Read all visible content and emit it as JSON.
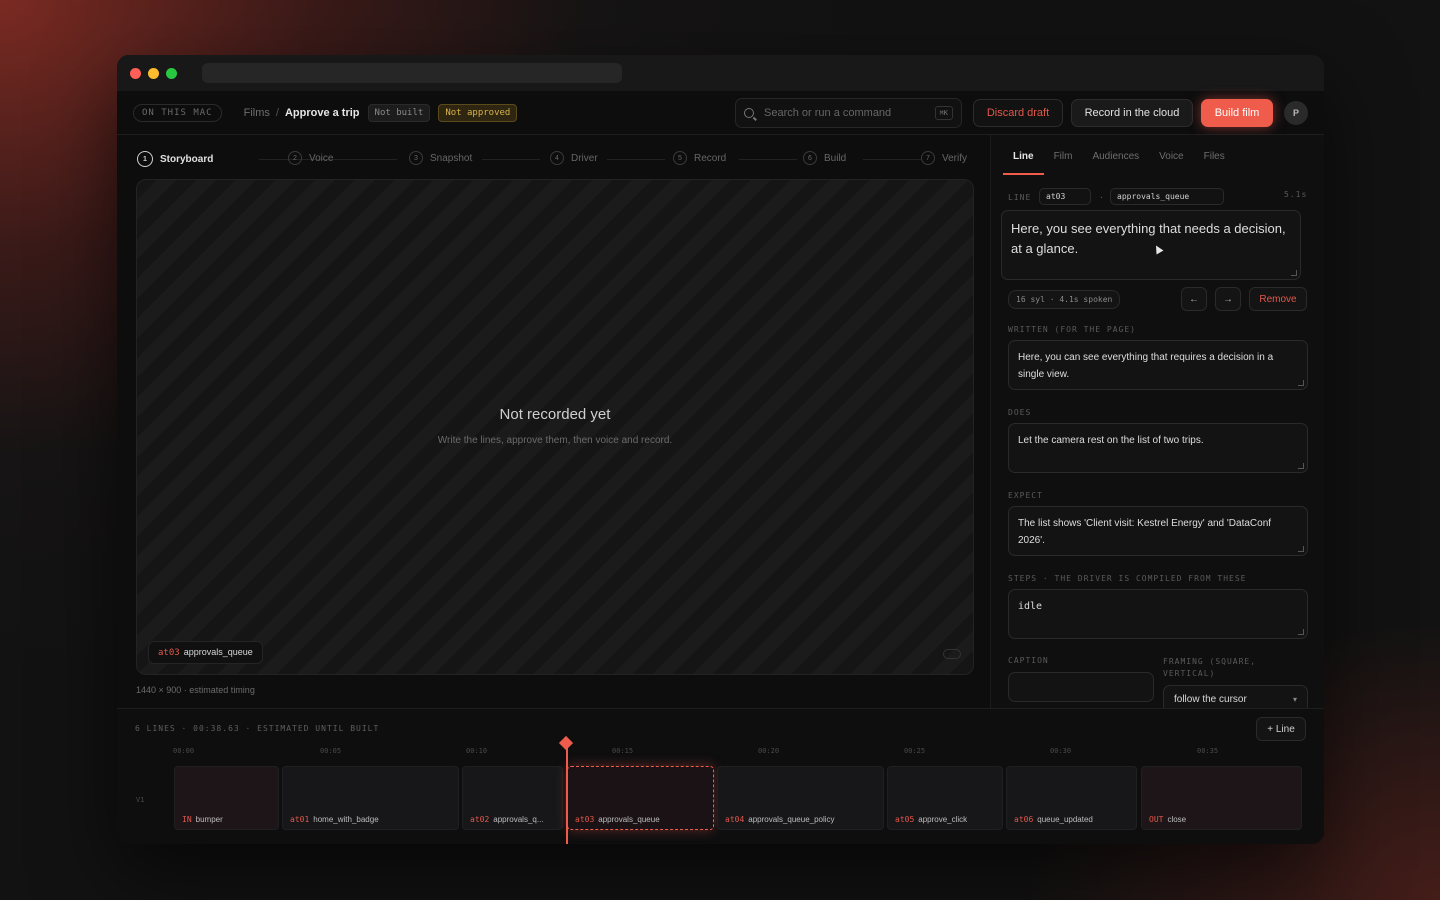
{
  "topbar": {
    "location": "ON THIS MAC",
    "breadcrumb_root": "Films",
    "breadcrumb_sep": "/",
    "breadcrumb_current": "Approve a trip",
    "badge_built": "Not built",
    "badge_approved": "Not approved",
    "search_placeholder": "Search or run a command",
    "search_shortcut": "⌘K",
    "discard_label": "Discard draft",
    "cloud_label": "Record in the cloud",
    "build_label": "Build film",
    "avatar_initial": "P"
  },
  "stepper": [
    {
      "num": "1",
      "label": "Storyboard"
    },
    {
      "num": "2",
      "label": "Voice"
    },
    {
      "num": "3",
      "label": "Snapshot"
    },
    {
      "num": "4",
      "label": "Driver"
    },
    {
      "num": "5",
      "label": "Record"
    },
    {
      "num": "6",
      "label": "Build"
    },
    {
      "num": "7",
      "label": "Verify"
    }
  ],
  "stage": {
    "title": "Not recorded yet",
    "subtitle": "Write the lines, approve them, then voice and record.",
    "chip_id": "at03",
    "chip_name": "approvals_queue",
    "dims": "1440 × 900 · estimated timing"
  },
  "panel": {
    "tabs": [
      "Line",
      "Film",
      "Audiences",
      "Voice",
      "Files"
    ],
    "line_label": "LINE",
    "line_id": "at03",
    "line_sep": "·",
    "line_name": "approvals_queue",
    "line_time": "5.1s",
    "spoken_text": "Here, you see everything that needs a decision, at a glance.",
    "stats": "16 syl · 4.1s spoken",
    "prev_label": "←",
    "next_label": "→",
    "remove_label": "Remove",
    "written_label": "WRITTEN (FOR THE PAGE)",
    "written_text": "Here, you can see everything that requires a decision in a single view.",
    "does_label": "DOES",
    "does_text": "Let the camera rest on the list of two trips.",
    "expect_label": "EXPECT",
    "expect_text": "The list shows 'Client visit: Kestrel Energy' and 'DataConf 2026'.",
    "steps_label": "STEPS · THE DRIVER IS COMPILED FROM THESE",
    "steps_text": "idle",
    "caption_label": "CAPTION",
    "caption_value": "",
    "framing_label": "FRAMING (SQUARE, VERTICAL)",
    "framing_value": "follow the cursor"
  },
  "timeline": {
    "header": "6 LINES · 00:38.63 · ESTIMATED UNTIL BUILT",
    "add_label": "+ Line",
    "track": "V1",
    "ticks": [
      "00:00",
      "00:05",
      "00:10",
      "00:15",
      "00:20",
      "00:25",
      "00:30",
      "00:35"
    ],
    "clips": [
      {
        "id": "IN",
        "name": "bumper"
      },
      {
        "id": "at01",
        "name": "home_with_badge"
      },
      {
        "id": "at02",
        "name": "approvals_q..."
      },
      {
        "id": "at03",
        "name": "approvals_queue"
      },
      {
        "id": "at04",
        "name": "approvals_queue_policy"
      },
      {
        "id": "at05",
        "name": "approve_click"
      },
      {
        "id": "at06",
        "name": "queue_updated"
      },
      {
        "id": "OUT",
        "name": "close"
      }
    ]
  },
  "colors": {
    "accent": "#ef5c4b",
    "amber": "#d9b24c"
  }
}
